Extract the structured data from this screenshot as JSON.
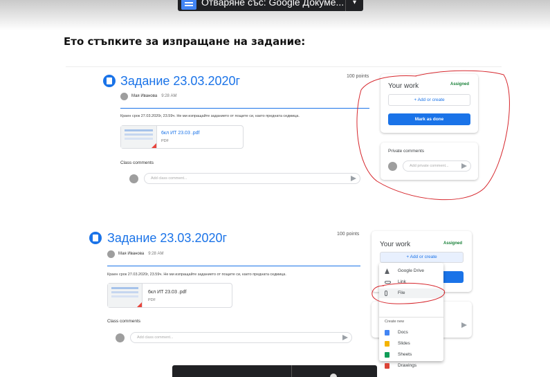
{
  "top_bar": {
    "open_label": "Отваряне със: Google Докуме..."
  },
  "heading": "Ето стъпките за изпращане на задание:",
  "assignment": {
    "title": "Задание 23.03.2020г",
    "points": "100 points",
    "author": "Мая Иванова",
    "time": "9:28 AM",
    "deadline": "Краен срок 27.03.2020г, 23.59ч. Не ми изпращайте заданието от пощите си, както предната седмица.",
    "attachment": {
      "name": "6кл ИТ 23.03 .pdf",
      "type": "PDF"
    },
    "class_comments_label": "Class comments",
    "comment_placeholder": "Add class comment..."
  },
  "your_work": {
    "label": "Your work",
    "status": "Assigned",
    "add_label": "Add or create",
    "done_label": "Mark as done",
    "private_label": "Private comments",
    "private_placeholder": "Add private comment..."
  },
  "add_menu": {
    "items": [
      {
        "label": "Google Drive",
        "icon": "google-drive-icon",
        "color": "#4285f4"
      },
      {
        "label": "Link",
        "icon": "link-icon",
        "color": "#5f6368"
      },
      {
        "label": "File",
        "icon": "paperclip-icon",
        "color": "#5f6368"
      }
    ],
    "create_label": "Create new",
    "create_items": [
      {
        "label": "Docs",
        "icon": "docs-icon",
        "color": "#4285f4"
      },
      {
        "label": "Slides",
        "icon": "slides-icon",
        "color": "#f4b400"
      },
      {
        "label": "Sheets",
        "icon": "sheets-icon",
        "color": "#0f9d58"
      },
      {
        "label": "Drawings",
        "icon": "drawings-icon",
        "color": "#db4437"
      }
    ]
  },
  "colors": {
    "accent": "#1a73e8",
    "assigned": "#188038",
    "annotation": "#d6262c"
  }
}
